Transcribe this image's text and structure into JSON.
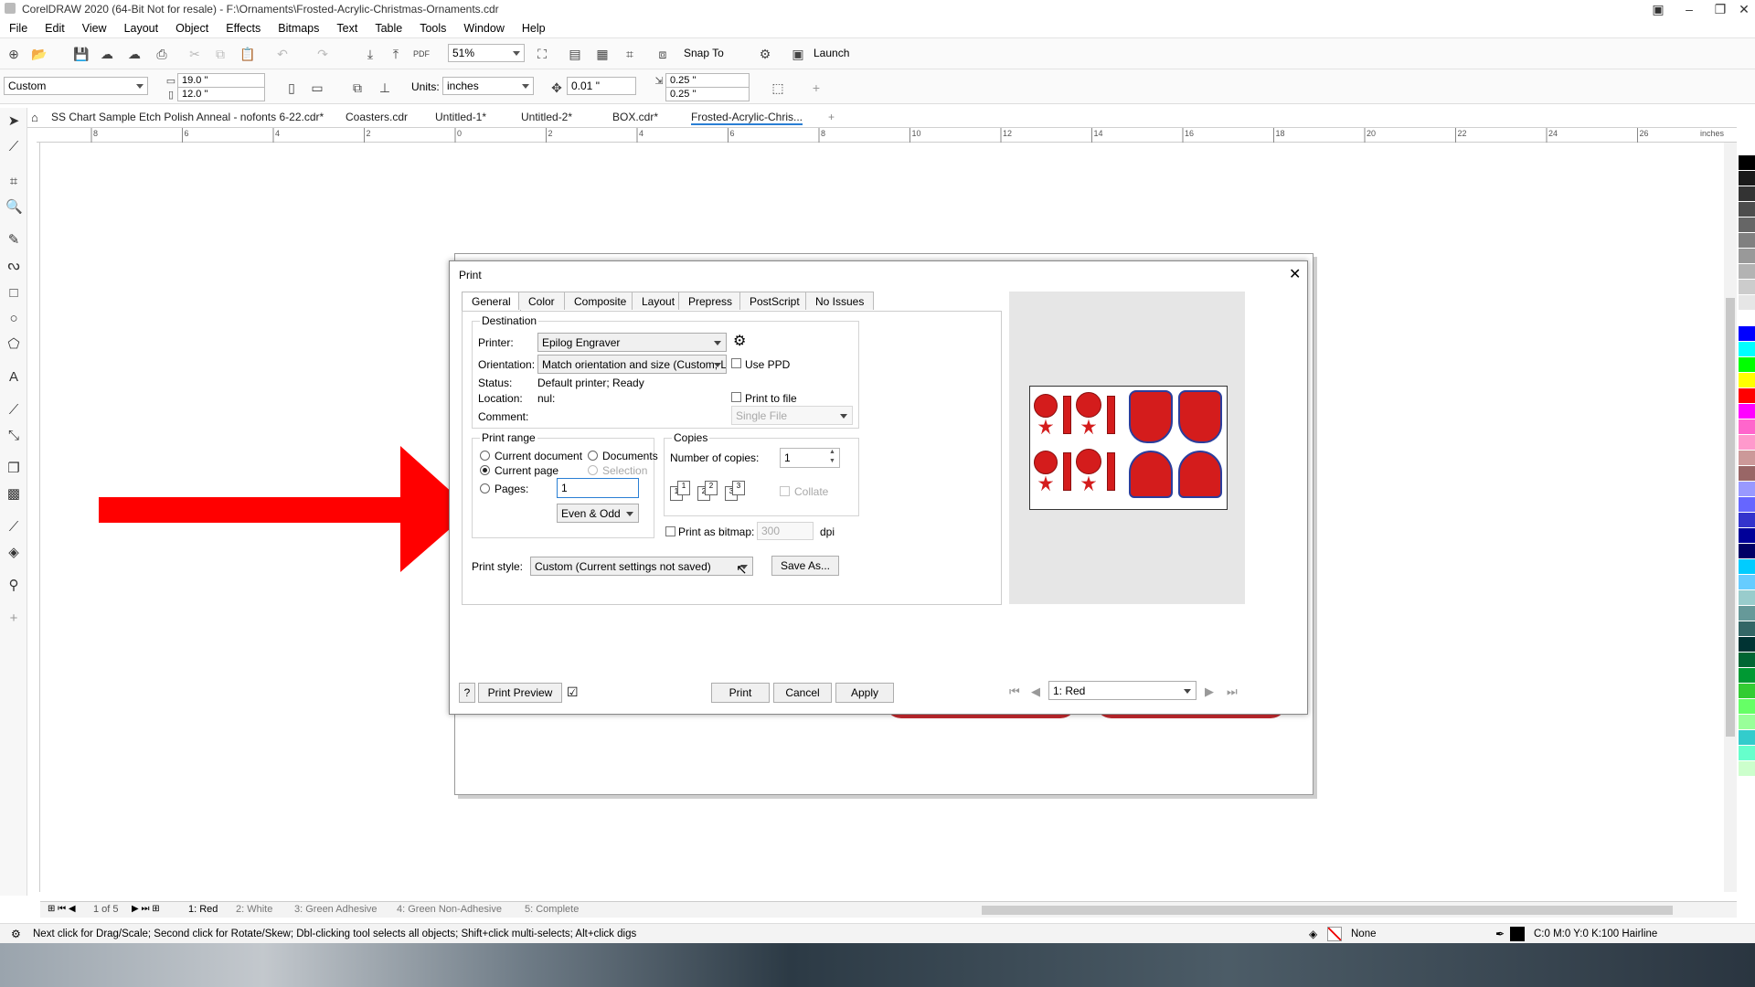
{
  "window": {
    "title": "CorelDRAW 2020 (64-Bit Not for resale) - F:\\Ornaments\\Frosted-Acrylic-Christmas-Ornaments.cdr"
  },
  "menu": [
    "File",
    "Edit",
    "View",
    "Layout",
    "Object",
    "Effects",
    "Bitmaps",
    "Text",
    "Table",
    "Tools",
    "Window",
    "Help"
  ],
  "toolbar": {
    "zoom": "51%",
    "snap_to": "Snap To",
    "launch": "Launch"
  },
  "propbar": {
    "page_size": "Custom",
    "width": "19.0 \"",
    "height": "12.0 \"",
    "units_label": "Units:",
    "units": "inches",
    "nudge": "0.01 \"",
    "dup_x": "0.25 \"",
    "dup_y": "0.25 \""
  },
  "doc_tabs": [
    "SS Chart Sample Etch Polish Anneal - nofonts 6-22.cdr*",
    "Coasters.cdr",
    "Untitled-1*",
    "Untitled-2*",
    "BOX.cdr*",
    "Frosted-Acrylic-Chris..."
  ],
  "ruler": {
    "unit": "inches",
    "h_labels": [
      "8",
      "6",
      "4",
      "2",
      "0",
      "2",
      "4",
      "6",
      "8",
      "10",
      "12",
      "14",
      "16",
      "18",
      "20",
      "22",
      "24",
      "26"
    ]
  },
  "dialog": {
    "title": "Print",
    "tabs": [
      "General",
      "Color",
      "Composite",
      "Layout",
      "Prepress",
      "PostScript",
      "No Issues"
    ],
    "destination": {
      "title": "Destination",
      "printer_label": "Printer:",
      "printer": "Epilog Engraver",
      "orientation_label": "Orientation:",
      "orientation": "Match orientation and size (Custom, Land...",
      "use_ppd": "Use PPD",
      "status_label": "Status:",
      "status": "Default printer; Ready",
      "location_label": "Location:",
      "location": "nul:",
      "print_to_file": "Print to file",
      "comment_label": "Comment:",
      "file_mode": "Single File"
    },
    "print_range": {
      "title": "Print range",
      "current_document": "Current document",
      "documents": "Documents",
      "current_page": "Current page",
      "selection": "Selection",
      "pages": "Pages:",
      "pages_value": "1",
      "even_odd": "Even & Odd"
    },
    "copies": {
      "title": "Copies",
      "number_label": "Number of copies:",
      "number": "1",
      "collate": "Collate",
      "icons": [
        "1",
        "1",
        "2",
        "2",
        "3",
        "3"
      ]
    },
    "bitmap": {
      "label": "Print as bitmap:",
      "dpi_value": "300",
      "dpi": "dpi"
    },
    "print_style_label": "Print style:",
    "print_style": "Custom (Current settings not saved)",
    "save_as": "Save As...",
    "help": "?",
    "print_preview": "Print Preview",
    "print": "Print",
    "cancel": "Cancel",
    "apply": "Apply",
    "preview_page": "1: Red"
  },
  "page_tabs": {
    "counter": "1 of 5",
    "tabs": [
      "1: Red",
      "2: White",
      "3: Green Adhesive",
      "4: Green Non-Adhesive",
      "5: Complete"
    ]
  },
  "status": {
    "hint": "Next click for Drag/Scale; Second click for Rotate/Skew; Dbl-clicking tool selects all objects; Shift+click multi-selects; Alt+click digs",
    "fill": "None",
    "outline": "C:0 M:0 Y:0 K:100  Hairline"
  },
  "palette": [
    "#000000",
    "#1a1a1a",
    "#333333",
    "#4d4d4d",
    "#666666",
    "#808080",
    "#999999",
    "#b3b3b3",
    "#cccccc",
    "#e6e6e6",
    "#ffffff",
    "#0000ff",
    "#00ffff",
    "#00ff00",
    "#ffff00",
    "#ff0000",
    "#ff00ff",
    "#ff66cc",
    "#ff99cc",
    "#cc9999",
    "#996666",
    "#9999ff",
    "#6666ff",
    "#3333cc",
    "#000099",
    "#000066",
    "#00ccff",
    "#66ccff",
    "#99cccc",
    "#669999",
    "#336666",
    "#003333",
    "#006633",
    "#009933",
    "#33cc33",
    "#66ff66",
    "#99ff99",
    "#33cccc",
    "#66ffcc",
    "#ccffcc"
  ],
  "arrow_color": "#ff0000"
}
